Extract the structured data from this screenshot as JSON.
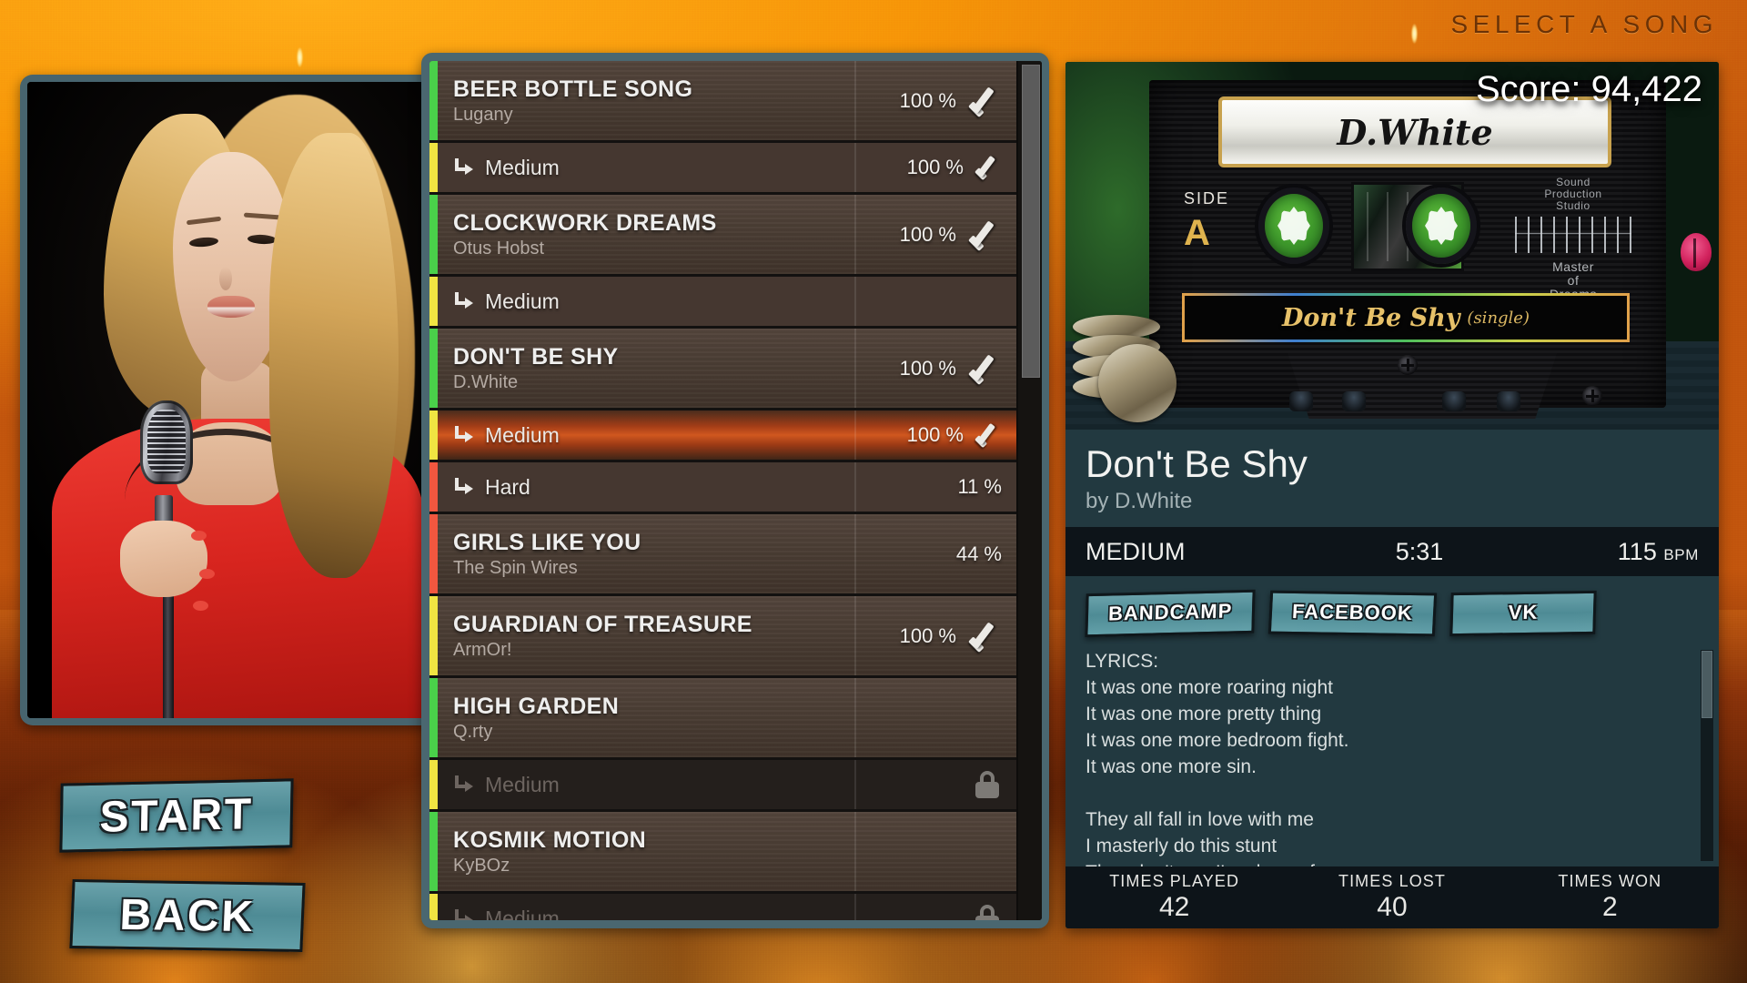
{
  "header": {
    "title": "SELECT A SONG"
  },
  "buttons": {
    "start": "START",
    "back": "BACK"
  },
  "photo": {
    "alt": "singer-photo"
  },
  "song_list": {
    "rows": [
      {
        "kind": "song",
        "title": "BEER BOTTLE SONG",
        "artist": "Lugany",
        "pct": "100 %",
        "check": true,
        "locked": false,
        "color": "#4ad04a"
      },
      {
        "kind": "diff",
        "label": "Medium",
        "pct": "100 %",
        "check": true,
        "locked": false,
        "color": "#f0e442"
      },
      {
        "kind": "song",
        "title": "CLOCKWORK DREAMS",
        "artist": "Otus Hobst",
        "pct": "100 %",
        "check": true,
        "locked": false,
        "color": "#4ad04a"
      },
      {
        "kind": "diff",
        "label": "Medium",
        "pct": "",
        "check": false,
        "locked": false,
        "color": "#f0e442"
      },
      {
        "kind": "song",
        "title": "DON'T BE SHY",
        "artist": "D.White",
        "pct": "100 %",
        "check": true,
        "locked": false,
        "color": "#4ad04a"
      },
      {
        "kind": "diff",
        "label": "Medium",
        "pct": "100 %",
        "check": true,
        "locked": false,
        "selected": true,
        "color": "#f0e442"
      },
      {
        "kind": "diff",
        "label": "Hard",
        "pct": "11 %",
        "check": false,
        "locked": false,
        "color": "#f2573f"
      },
      {
        "kind": "song",
        "title": "GIRLS LIKE YOU",
        "artist": "The Spin Wires",
        "pct": "44 %",
        "check": false,
        "locked": false,
        "color": "#f2573f"
      },
      {
        "kind": "song",
        "title": "GUARDIAN OF TREASURE",
        "artist": "ArmOr!",
        "pct": "100 %",
        "check": true,
        "locked": false,
        "color": "#f0e442"
      },
      {
        "kind": "song",
        "title": "HIGH GARDEN",
        "artist": "Q.rty",
        "pct": "",
        "check": false,
        "locked": false,
        "color": "#4ad04a"
      },
      {
        "kind": "diff",
        "label": "Medium",
        "pct": "",
        "check": false,
        "locked": true,
        "color": "#f0e442"
      },
      {
        "kind": "song",
        "title": "KOSMIK MOTION",
        "artist": "KyBOz",
        "pct": "",
        "check": false,
        "locked": false,
        "color": "#4ad04a"
      },
      {
        "kind": "diff",
        "label": "Medium",
        "pct": "",
        "check": false,
        "locked": true,
        "color": "#f0e442"
      }
    ]
  },
  "detail": {
    "score_label": "Score: 94,422",
    "cassette": {
      "artist_label": "D.White",
      "side_word": "SIDE",
      "side_letter": "A",
      "studio": "Sound\nProduction\nStudio",
      "master": "Master\nof\nDreams",
      "title": "Don't Be Shy",
      "title_suffix": "(single)"
    },
    "song_title": "Don't Be Shy",
    "song_artist": "by D.White",
    "difficulty": "MEDIUM",
    "duration": "5:31",
    "bpm_value": "115",
    "bpm_unit": "BPM",
    "links": [
      {
        "label": "BANDCAMP"
      },
      {
        "label": "FACEBOOK"
      },
      {
        "label": "VK"
      }
    ],
    "lyrics_heading": "LYRICS:",
    "lyrics": "It was one more roaring night\nIt was one more pretty thing\nIt was one more bedroom fight.\nIt was one more sin.\n\nThey all fall in love with me\nI masterly do this stunt\nThey don't see I'm always free",
    "stats": [
      {
        "key": "TIMES PLAYED",
        "value": "42"
      },
      {
        "key": "TIMES LOST",
        "value": "40"
      },
      {
        "key": "TIMES WON",
        "value": "2"
      }
    ]
  },
  "colors": {
    "accent_teal": "#4e8b95",
    "panel_frame": "#4a6770",
    "background_orange": "#ef8a0c",
    "easy_green": "#4ad04a",
    "medium_yellow": "#f0e442",
    "hard_red": "#f2573f",
    "selected_orange": "#d0571f"
  }
}
